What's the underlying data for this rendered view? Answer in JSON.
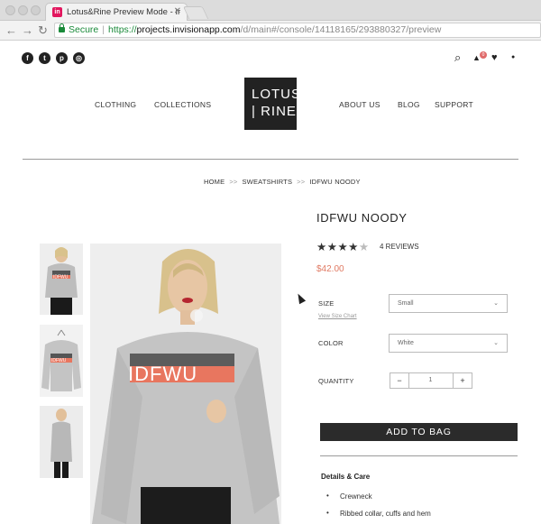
{
  "browser": {
    "tab_title": "Lotus&Rine Preview Mode - Ir",
    "tab_favicon": "in",
    "close_glyph": "✕",
    "back_glyph": "←",
    "forward_glyph": "→",
    "reload_glyph": "↻",
    "secure_label": "Secure",
    "separator": "|",
    "url_scheme": "https://",
    "url_host": "projects.invisionapp.com",
    "url_path": "/d/main#/console/14118165/293880327/preview"
  },
  "social": [
    {
      "icon": "facebook-icon",
      "glyph": "f"
    },
    {
      "icon": "twitter-icon",
      "glyph": "t"
    },
    {
      "icon": "pinterest-icon",
      "glyph": "p"
    },
    {
      "icon": "instagram-icon",
      "glyph": "◎"
    }
  ],
  "utility": {
    "search_glyph": "⌕",
    "cart_glyph": "▲",
    "cart_count": "0",
    "wishlist_glyph": "♥",
    "account_glyph": "●"
  },
  "nav": {
    "clothing": "CLOTHING",
    "collections": "COLLECTIONS",
    "about": "ABOUT US",
    "blog": "BLOG",
    "support": "SUPPORT"
  },
  "logo": {
    "line1": "LOTUS",
    "line2": "| RINE"
  },
  "breadcrumb": {
    "home": "HOME",
    "category": "SWEATSHIRTS",
    "current": "IDFWU NOODY",
    "separator": ">>"
  },
  "product": {
    "title": "IDFWU NOODY",
    "rating": 4,
    "rating_max": 5,
    "reviews": "4 REVIEWS",
    "price": "$42.00",
    "print_text": "IDFWU",
    "print_mini": "IDFWU"
  },
  "options": {
    "size_label": "SIZE",
    "size_value": "Small",
    "size_guide": "View Size Chart",
    "color_label": "COLOR",
    "color_value": "White",
    "chevron": "⌄",
    "quantity_label": "QUANTITY",
    "qty_minus": "−",
    "qty_value": "1",
    "qty_plus": "+"
  },
  "cta": {
    "add_to_bag": "ADD TO BAG"
  },
  "details": {
    "title": "Details & Care",
    "items": [
      "Crewneck",
      "Ribbed collar, cuffs and hem"
    ]
  },
  "colors": {
    "print_accent": "#e8765f",
    "price": "#e07a63",
    "button_bg": "#2b2b2b"
  }
}
